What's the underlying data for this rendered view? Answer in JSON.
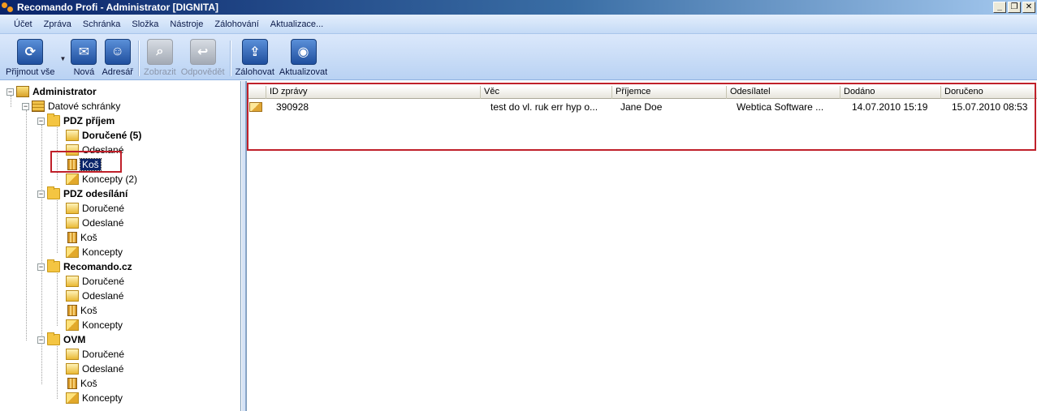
{
  "window": {
    "title": "Recomando Profi - Administrator [DIGNITA]",
    "controls": [
      "_",
      "❐",
      "✕"
    ]
  },
  "menu": [
    "Účet",
    "Zpráva",
    "Schránka",
    "Složka",
    "Nástroje",
    "Zálohování",
    "Aktualizace..."
  ],
  "toolbar": {
    "receive_all": "Přijmout vše",
    "new": "Nová",
    "address_book": "Adresář",
    "show": "Zobrazit",
    "reply": "Odpovědět",
    "backup": "Zálohovat",
    "update": "Aktualizovat"
  },
  "tree": {
    "root": "Administrator",
    "datove": "Datové schránky",
    "groups": [
      {
        "name": "PDZ příjem",
        "items": [
          "Doručené (5)",
          "Odeslané",
          "Koš",
          "Koncepty (2)"
        ]
      },
      {
        "name": "PDZ odesílání",
        "items": [
          "Doručené",
          "Odeslané",
          "Koš",
          "Koncepty"
        ]
      },
      {
        "name": "Recomando.cz",
        "items": [
          "Doručené",
          "Odeslané",
          "Koš",
          "Koncepty"
        ]
      },
      {
        "name": "OVM",
        "items": [
          "Doručené",
          "Odeslané",
          "Koš",
          "Koncepty"
        ]
      }
    ]
  },
  "list": {
    "columns": [
      "ID zprávy",
      "Věc",
      "Příjemce",
      "Odesílatel",
      "Dodáno",
      "Doručeno"
    ],
    "rows": [
      {
        "id": "390928",
        "subject": "test do vl. ruk err hyp o...",
        "recipient": "Jane Doe",
        "sender": "Webtica Software ...",
        "delivered_to": "14.07.2010 15:19",
        "delivered": "15.07.2010 08:53"
      }
    ]
  },
  "colors": {
    "highlight": "#c0202a",
    "selection": "#0a246a"
  }
}
